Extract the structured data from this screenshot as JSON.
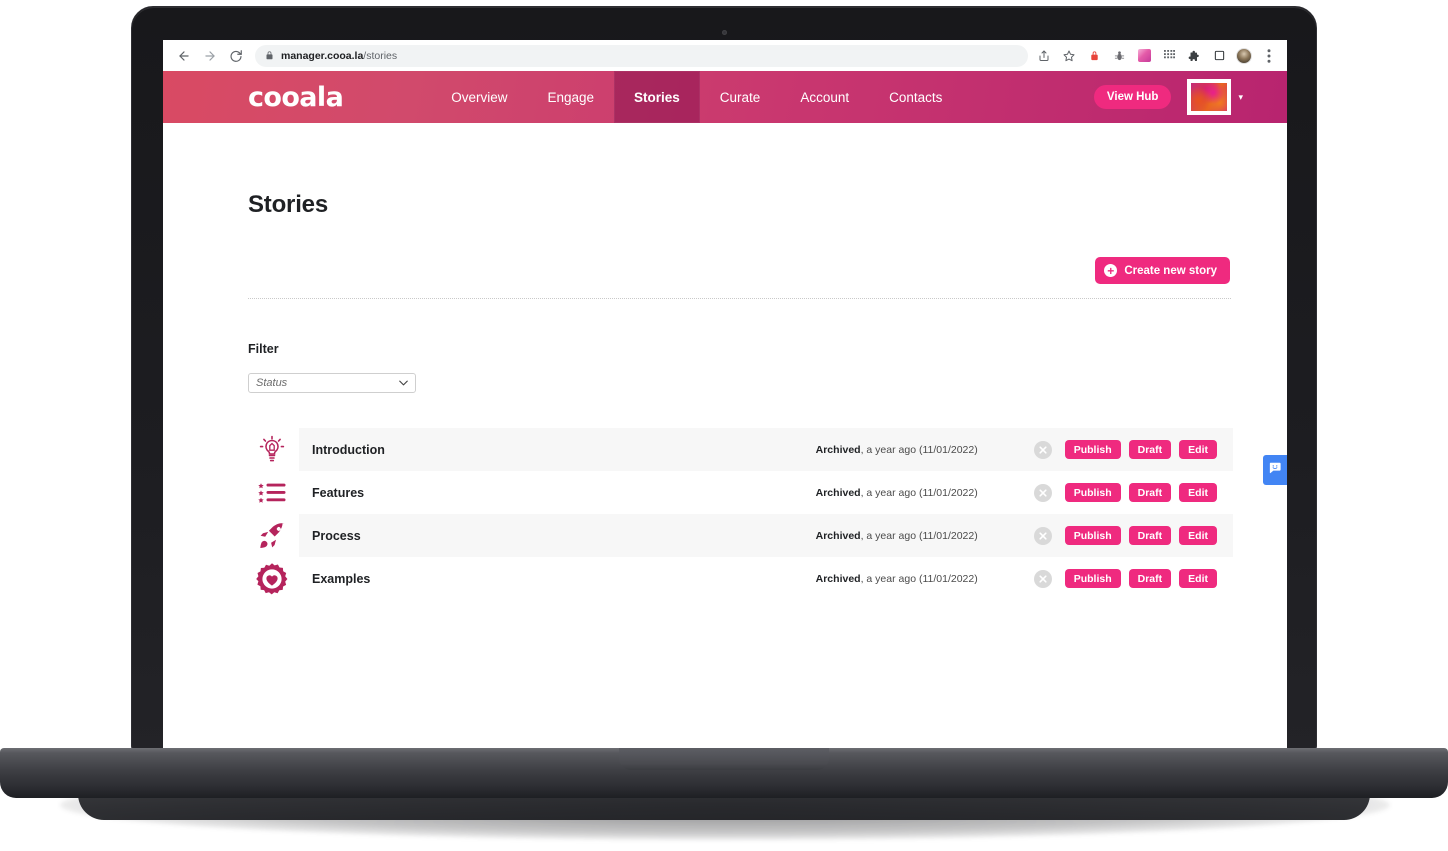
{
  "browser": {
    "back_icon": "back-arrow-icon",
    "forward_icon": "forward-arrow-icon",
    "reload_icon": "reload-icon",
    "url_host": "manager.cooa.la",
    "url_path": "/stories",
    "share_icon": "share-icon",
    "bookmark_icon": "star-icon",
    "ext_lock_icon": "lock-extension-icon",
    "ext_bug_icon": "bug-extension-icon",
    "ext_gradient_icon": "gradient-extension-icon",
    "ext_grid_icon": "grid-extension-icon",
    "ext_puzzle_icon": "puzzle-extension-icon",
    "ext_square_icon": "square-extension-icon",
    "profile_icon": "profile-avatar-icon",
    "menu_icon": "three-dot-menu-icon"
  },
  "header": {
    "brand": "cooala",
    "nav": [
      {
        "label": "Overview",
        "active": false
      },
      {
        "label": "Engage",
        "active": false
      },
      {
        "label": "Stories",
        "active": true
      },
      {
        "label": "Curate",
        "active": false
      },
      {
        "label": "Account",
        "active": false
      },
      {
        "label": "Contacts",
        "active": false
      }
    ],
    "view_hub_label": "View Hub",
    "avatar_caret": "▾",
    "accent_pink": "#ef2a7f",
    "header_gradient_start": "#d94a63",
    "header_gradient_end": "#b8246f"
  },
  "main": {
    "title": "Stories",
    "create_button_label": "Create new story",
    "create_button_icon": "plus-circle-icon",
    "filter_label": "Filter",
    "filter_select_value": "Status",
    "filter_select_caret": "⌄"
  },
  "stories": [
    {
      "icon": "lightbulb-icon",
      "title": "Introduction",
      "status": "Archived",
      "meta": ", a year ago (11/01/2022)",
      "delete_icon": "close-circle-icon",
      "actions": [
        "Publish",
        "Draft",
        "Edit"
      ]
    },
    {
      "icon": "star-list-icon",
      "title": "Features",
      "status": "Archived",
      "meta": ", a year ago (11/01/2022)",
      "delete_icon": "close-circle-icon",
      "actions": [
        "Publish",
        "Draft",
        "Edit"
      ]
    },
    {
      "icon": "rocket-icon",
      "title": "Process",
      "status": "Archived",
      "meta": ", a year ago (11/01/2022)",
      "delete_icon": "close-circle-icon",
      "actions": [
        "Publish",
        "Draft",
        "Edit"
      ]
    },
    {
      "icon": "heart-badge-icon",
      "title": "Examples",
      "status": "Archived",
      "meta": ", a year ago (11/01/2022)",
      "delete_icon": "close-circle-icon",
      "actions": [
        "Publish",
        "Draft",
        "Edit"
      ]
    }
  ],
  "feedback": {
    "icon": "smiley-chat-icon",
    "color": "#4285f4"
  }
}
